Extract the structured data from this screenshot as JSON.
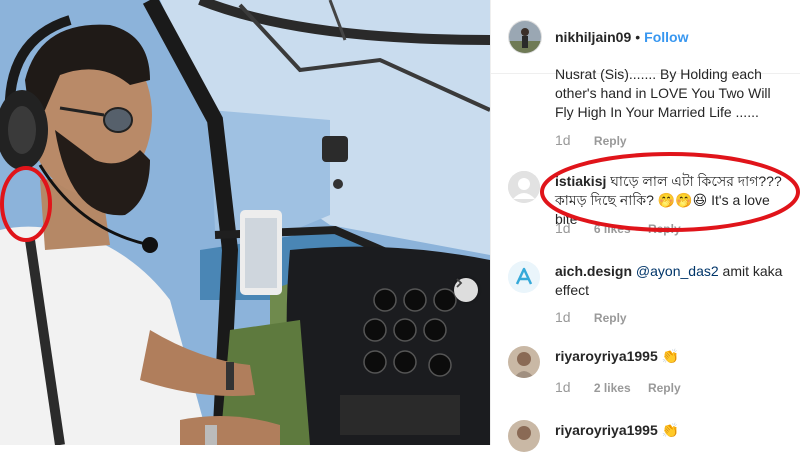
{
  "post": {
    "username": "nikhiljain09",
    "separator": "•",
    "follow_label": "Follow"
  },
  "comments": [
    {
      "text": "Nusrat (Sis)....... By Holding each other's hand in LOVE You Two Will Fly High In Your Married Life ......",
      "age": "1d",
      "reply": "Reply"
    },
    {
      "user": "istiakisj",
      "text": "ঘাড়ে লাল এটা কিসের দাগ??? কামড় দিছে নাকি? 🤭🤭😆 It's a love bite",
      "age": "1d",
      "likes": "6 likes",
      "reply": "Reply"
    },
    {
      "user": "aich.design",
      "mention": "@ayon_das2",
      "text": "amit kaka effect",
      "age": "1d",
      "reply": "Reply"
    },
    {
      "user": "riyaroyriya1995",
      "emoji": "👏",
      "age": "1d",
      "likes": "2 likes",
      "reply": "Reply"
    },
    {
      "user": "riyaroyriya1995",
      "emoji": "👏"
    }
  ],
  "colors": {
    "follow": "#3897f0",
    "highlight": "#e0141a",
    "meta": "#999999"
  },
  "icons": {
    "carousel_next": "chevron-right-icon",
    "aich_logo": "a-letter-logo-icon"
  }
}
